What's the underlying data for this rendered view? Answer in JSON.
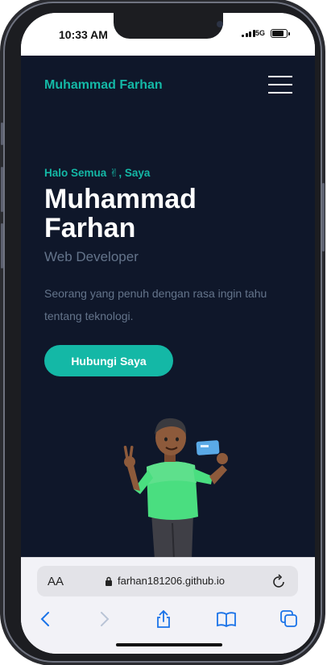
{
  "status": {
    "time": "10:33 AM",
    "network": "5G"
  },
  "site": {
    "brand": "Muhammad Farhan",
    "greeting": "Halo Semua ✌, Saya",
    "name": "Muhammad Farhan",
    "role": "Web Developer",
    "description": "Seorang yang penuh dengan rasa ingin tahu tentang teknologi.",
    "cta_label": "Hubungi Saya",
    "colors": {
      "background": "#0f172a",
      "accent": "#14b8a6",
      "muted": "#64748b"
    }
  },
  "browser": {
    "text_size_label": "AA",
    "url": "farhan181206.github.io",
    "icons": [
      "text-size-icon",
      "lock-icon",
      "reload-icon",
      "back-icon",
      "forward-icon",
      "share-icon",
      "bookmarks-icon",
      "tabs-icon"
    ]
  }
}
